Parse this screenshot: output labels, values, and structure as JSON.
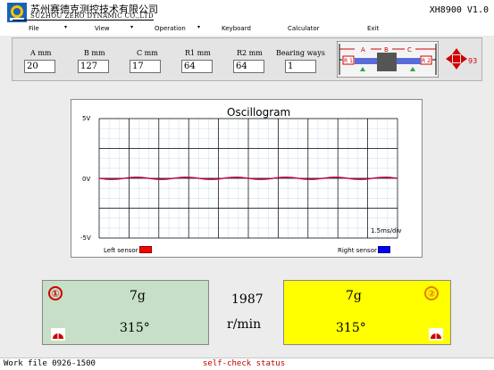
{
  "header": {
    "company_cn": "苏州赛德克测控技术有限公司",
    "company_en": "SUZHOU ZERO DYNAMIC CO.,LTD",
    "version": "XH8900 V1.0"
  },
  "menu": [
    {
      "label": "File",
      "has_dropdown": true
    },
    {
      "label": "View",
      "has_dropdown": true
    },
    {
      "label": "Operation",
      "has_dropdown": true
    },
    {
      "label": "Keyboard",
      "has_dropdown": false
    },
    {
      "label": "Calculator",
      "has_dropdown": false
    },
    {
      "label": "Exit",
      "has_dropdown": false
    }
  ],
  "params": {
    "a": {
      "label": "A mm",
      "value": "20"
    },
    "b": {
      "label": "B mm",
      "value": "127"
    },
    "c": {
      "label": "C mm",
      "value": "17"
    },
    "r1": {
      "label": "R1 mm",
      "value": "64"
    },
    "r2": {
      "label": "R2 mm",
      "value": "64"
    },
    "bearing": {
      "label": "Bearing ways",
      "value": "1"
    }
  },
  "rotor_diagram": {
    "a": "A",
    "b": "B",
    "c": "C",
    "r1": "R 1",
    "r2": "R 2"
  },
  "nav_number": "93",
  "oscillogram": {
    "title": "Oscillogram",
    "y_labels": {
      "top": "5V",
      "mid": "0V",
      "bottom": "-5V"
    },
    "time_scale": "1.5ms/div",
    "legend_left": "Left sensor",
    "legend_right": "Right sensor",
    "left_color": "#ff0000",
    "right_color": "#0000ff",
    "trace_color": "#c00040"
  },
  "results": {
    "left": {
      "index": "①",
      "mass": "7g",
      "angle": "315°",
      "bg": "#c6dfc6"
    },
    "right": {
      "index": "②",
      "mass": "7g",
      "angle": "315°",
      "bg": "#ffff00"
    },
    "speed": "1987",
    "speed_unit": "r/min"
  },
  "status": {
    "work_file": "Work file 0926-1500",
    "message": "self-check status"
  }
}
